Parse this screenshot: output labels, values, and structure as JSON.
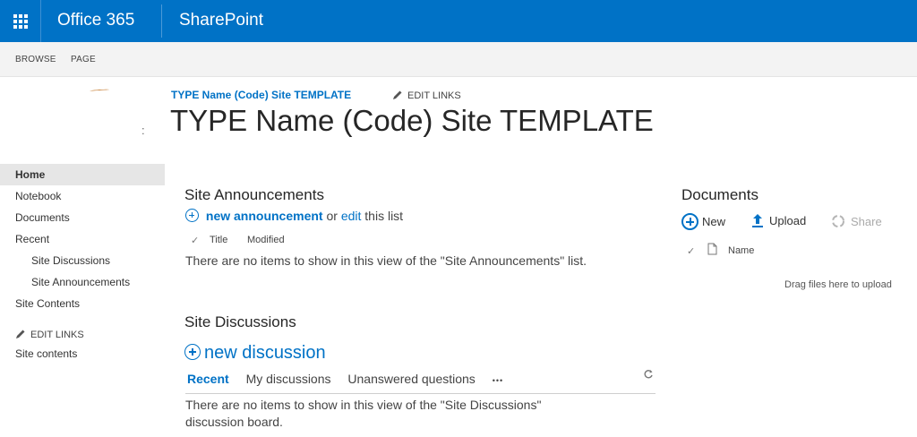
{
  "suitebar": {
    "app_launcher_icon": "waffle-icon",
    "brand": "Office 365",
    "product": "SharePoint",
    "background_color": "#0072c6"
  },
  "ribbon": {
    "tabs": [
      "BROWSE",
      "PAGE"
    ]
  },
  "header": {
    "breadcrumb": "TYPE Name (Code) Site TEMPLATE",
    "edit_links": "EDIT LINKS",
    "page_title": "TYPE Name (Code) Site TEMPLATE",
    "logo_fragment": ":"
  },
  "leftnav": {
    "items": [
      {
        "label": "Home",
        "selected": true
      },
      {
        "label": "Notebook"
      },
      {
        "label": "Documents"
      },
      {
        "label": "Recent"
      },
      {
        "label": "Site Discussions",
        "sub": true
      },
      {
        "label": "Site Announcements",
        "sub": true
      },
      {
        "label": "Site Contents"
      }
    ],
    "edit_links": "EDIT LINKS",
    "site_contents": "Site contents"
  },
  "announcements": {
    "title": "Site Announcements",
    "new_label": "new announcement",
    "or_text": "or",
    "edit_label": "edit",
    "this_list": "this list",
    "columns": [
      "Title",
      "Modified"
    ],
    "empty_message": "There are no items to show in this view of the \"Site Announcements\" list."
  },
  "discussions": {
    "title": "Site Discussions",
    "new_label": "new discussion",
    "tabs": [
      "Recent",
      "My discussions",
      "Unanswered questions"
    ],
    "more": "•••",
    "empty_line1": "There are no items to show in this view of the \"Site Discussions\"",
    "empty_line2": "discussion board."
  },
  "documents": {
    "title": "Documents",
    "new_label": "New",
    "upload_label": "Upload",
    "share_label": "Share",
    "column_name": "Name",
    "drag_note": "Drag files here to upload",
    "accent_color": "#0072c6"
  }
}
